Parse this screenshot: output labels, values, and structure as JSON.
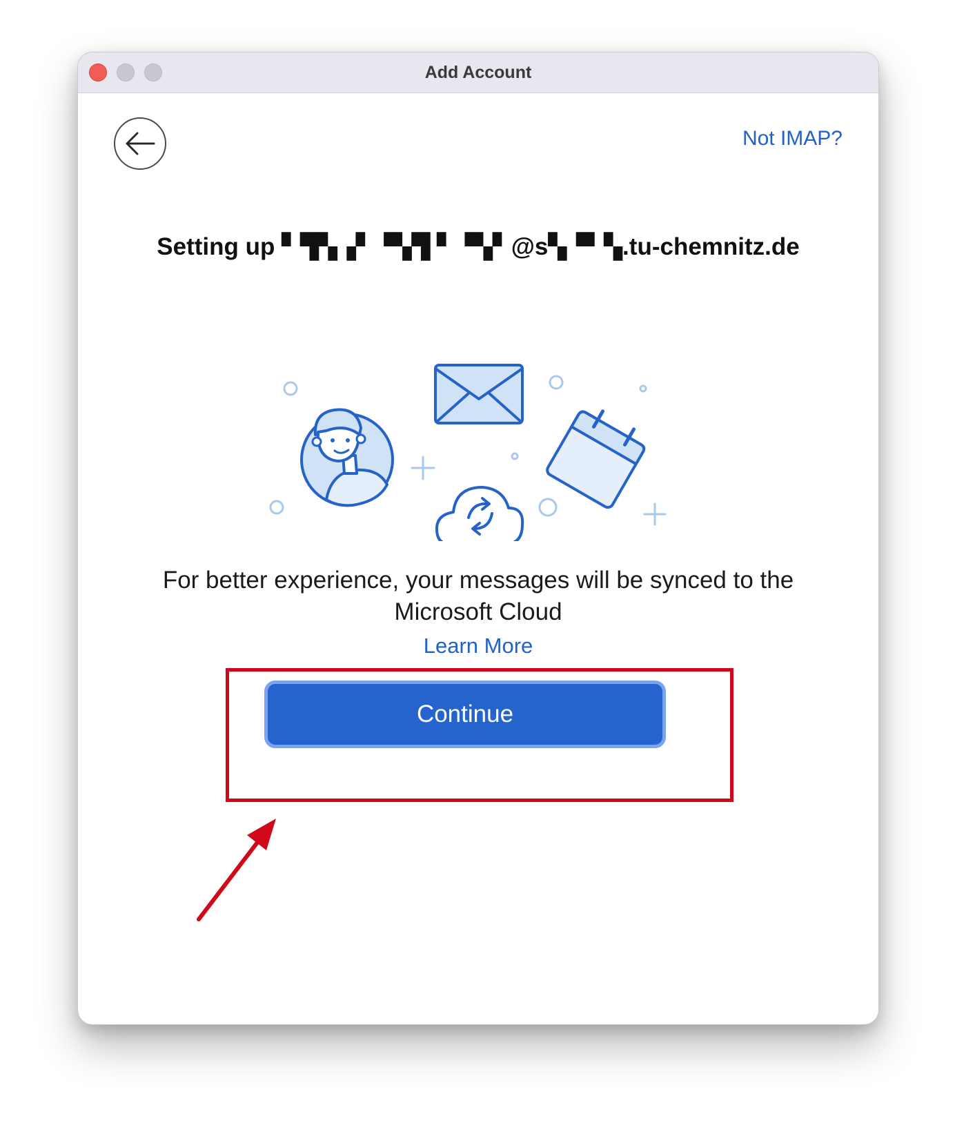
{
  "window": {
    "title": "Add Account"
  },
  "header": {
    "back_icon": "arrow-left-icon",
    "not_imap_label": "Not IMAP?"
  },
  "setup": {
    "title": "Setting up ▘▜▚▗▘▝▚▜ ▘▝▚▘@s▚▝▘▚.tu-chemnitz.de"
  },
  "illustration": {
    "icons": [
      "person-avatar-icon",
      "envelope-icon",
      "calendar-icon",
      "cloud-sync-icon"
    ],
    "colors": {
      "stroke": "#2563c9",
      "fill": "#cfe2f6",
      "light": "#e4effb",
      "decor": "#a9c8ea"
    }
  },
  "body": {
    "message": "For better experience, your messages will be synced to the Microsoft Cloud",
    "learn_more_label": "Learn More"
  },
  "actions": {
    "continue_label": "Continue"
  },
  "colors": {
    "accent": "#2564cd",
    "link": "#2161c8",
    "annotation": "#d0091a"
  }
}
